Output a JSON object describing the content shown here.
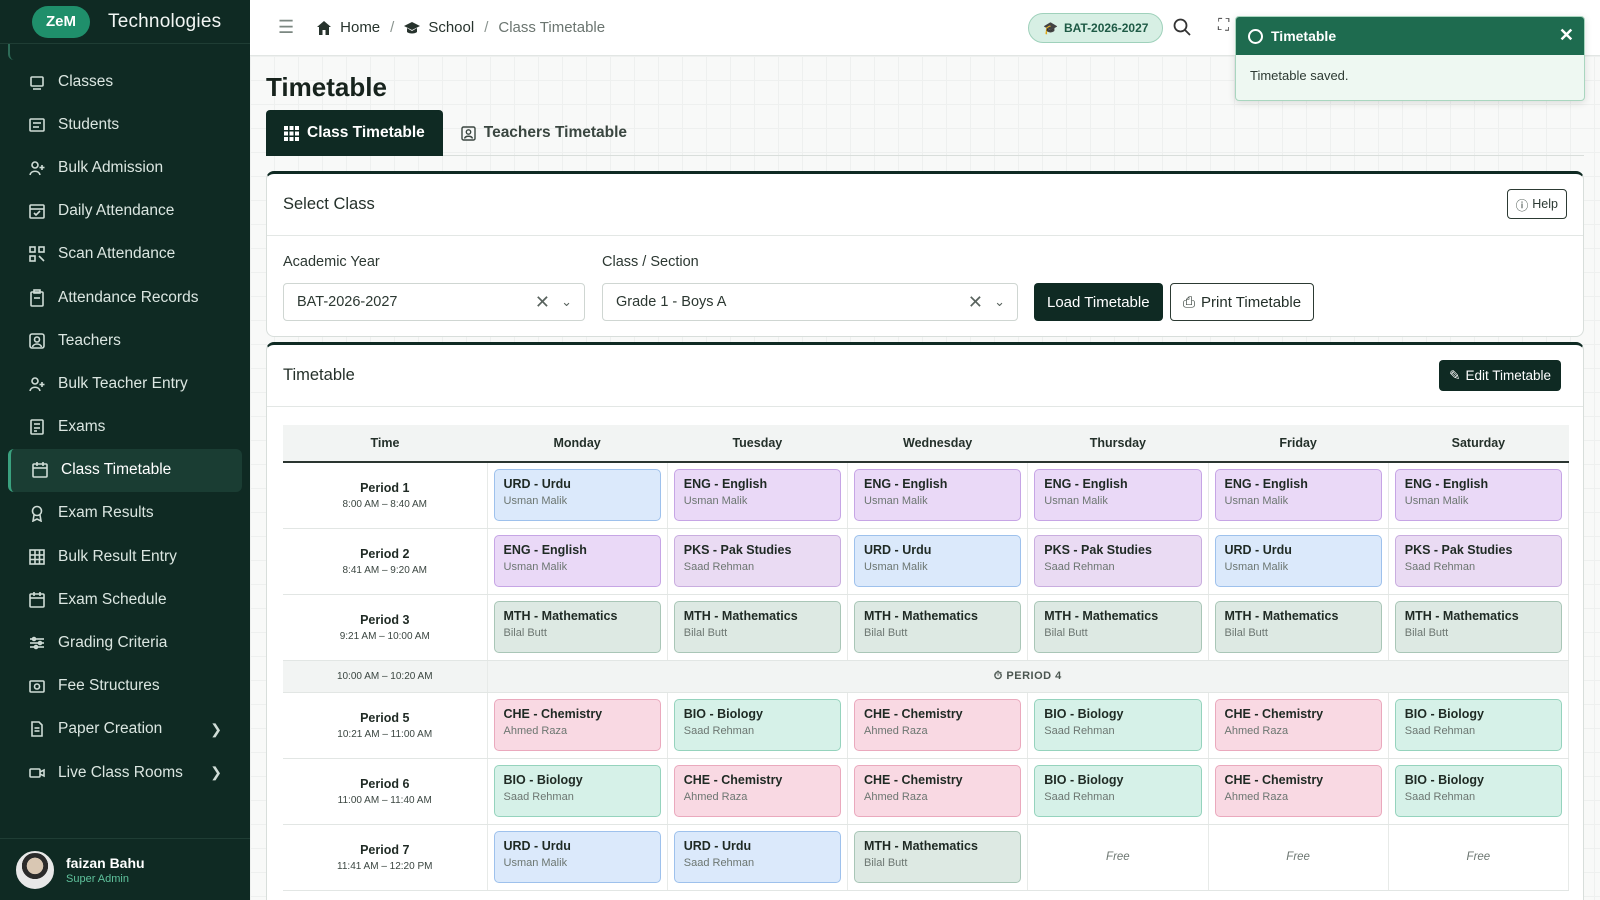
{
  "brand": {
    "logo": "ZeM",
    "name": "Technologies"
  },
  "sidebar": {
    "items": [
      {
        "label": "Classes",
        "icon": "classes-icon"
      },
      {
        "label": "Students",
        "icon": "students-icon"
      },
      {
        "label": "Bulk Admission",
        "icon": "user-plus-icon"
      },
      {
        "label": "Daily Attendance",
        "icon": "calendar-check-icon"
      },
      {
        "label": "Scan Attendance",
        "icon": "qr-scan-icon"
      },
      {
        "label": "Attendance Records",
        "icon": "clipboard-icon"
      },
      {
        "label": "Teachers",
        "icon": "teacher-icon"
      },
      {
        "label": "Bulk Teacher Entry",
        "icon": "user-add-icon"
      },
      {
        "label": "Exams",
        "icon": "exam-icon"
      },
      {
        "label": "Class Timetable",
        "icon": "calendar-icon",
        "active": true
      },
      {
        "label": "Exam Results",
        "icon": "award-icon"
      },
      {
        "label": "Bulk Result Entry",
        "icon": "grid-icon"
      },
      {
        "label": "Exam Schedule",
        "icon": "calendar-icon"
      },
      {
        "label": "Grading Criteria",
        "icon": "sliders-icon"
      },
      {
        "label": "Fee Structures",
        "icon": "wallet-icon"
      },
      {
        "label": "Paper Creation",
        "icon": "document-icon",
        "chevron": true
      },
      {
        "label": "Live Class Rooms",
        "icon": "video-icon",
        "chevron": true
      }
    ],
    "user": {
      "name": "faizan Bahu",
      "role": "Super Admin"
    }
  },
  "topbar": {
    "breadcrumb": [
      "Home",
      "School",
      "Class Timetable"
    ],
    "academic_year": "BAT-2026-2027"
  },
  "toast": {
    "title": "Timetable",
    "message": "Timetable saved."
  },
  "page": {
    "title": "Timetable",
    "tabs": [
      "Class Timetable",
      "Teachers Timetable"
    ]
  },
  "select_card": {
    "title": "Select Class",
    "help_label": "Help",
    "academic_year_label": "Academic Year",
    "academic_year_value": "BAT-2026-2027",
    "class_label": "Class / Section",
    "class_value": "Grade 1 - Boys A",
    "load_label": "Load Timetable",
    "print_label": "Print Timetable"
  },
  "timetable": {
    "title": "Timetable",
    "edit_label": "Edit Timetable",
    "headers": [
      "Time",
      "Monday",
      "Tuesday",
      "Wednesday",
      "Thursday",
      "Friday",
      "Saturday"
    ],
    "free_label": "Free",
    "rows": [
      {
        "name": "Period 1",
        "time": "8:00 AM – 8:40 AM",
        "slots": [
          [
            "urd",
            "URD - Urdu",
            "Usman Malik"
          ],
          [
            "eng",
            "ENG - English",
            "Usman Malik"
          ],
          [
            "eng",
            "ENG - English",
            "Usman Malik"
          ],
          [
            "eng",
            "ENG - English",
            "Usman Malik"
          ],
          [
            "eng",
            "ENG - English",
            "Usman Malik"
          ],
          [
            "eng",
            "ENG - English",
            "Usman Malik"
          ]
        ]
      },
      {
        "name": "Period 2",
        "time": "8:41 AM – 9:20 AM",
        "slots": [
          [
            "eng",
            "ENG - English",
            "Usman Malik"
          ],
          [
            "pks",
            "PKS - Pak Studies",
            "Saad Rehman"
          ],
          [
            "urd",
            "URD - Urdu",
            "Usman Malik"
          ],
          [
            "pks",
            "PKS - Pak Studies",
            "Saad Rehman"
          ],
          [
            "urd",
            "URD - Urdu",
            "Usman Malik"
          ],
          [
            "pks",
            "PKS - Pak Studies",
            "Saad Rehman"
          ]
        ]
      },
      {
        "name": "Period 3",
        "time": "9:21 AM – 10:00 AM",
        "slots": [
          [
            "mth",
            "MTH - Mathematics",
            "Bilal Butt"
          ],
          [
            "mth",
            "MTH - Mathematics",
            "Bilal Butt"
          ],
          [
            "mth",
            "MTH - Mathematics",
            "Bilal Butt"
          ],
          [
            "mth",
            "MTH - Mathematics",
            "Bilal Butt"
          ],
          [
            "mth",
            "MTH - Mathematics",
            "Bilal Butt"
          ],
          [
            "mth",
            "MTH - Mathematics",
            "Bilal Butt"
          ]
        ]
      },
      {
        "break": true,
        "time": "10:00 AM – 10:20 AM",
        "label": "PERIOD 4"
      },
      {
        "name": "Period 5",
        "time": "10:21 AM – 11:00 AM",
        "slots": [
          [
            "che",
            "CHE - Chemistry",
            "Ahmed Raza"
          ],
          [
            "bio",
            "BIO - Biology",
            "Saad Rehman"
          ],
          [
            "che",
            "CHE - Chemistry",
            "Ahmed Raza"
          ],
          [
            "bio",
            "BIO - Biology",
            "Saad Rehman"
          ],
          [
            "che",
            "CHE - Chemistry",
            "Ahmed Raza"
          ],
          [
            "bio",
            "BIO - Biology",
            "Saad Rehman"
          ]
        ]
      },
      {
        "name": "Period 6",
        "time": "11:00 AM – 11:40 AM",
        "slots": [
          [
            "bio",
            "BIO - Biology",
            "Saad Rehman"
          ],
          [
            "che",
            "CHE - Chemistry",
            "Ahmed Raza"
          ],
          [
            "che",
            "CHE - Chemistry",
            "Ahmed Raza"
          ],
          [
            "bio",
            "BIO - Biology",
            "Saad Rehman"
          ],
          [
            "che",
            "CHE - Chemistry",
            "Ahmed Raza"
          ],
          [
            "bio",
            "BIO - Biology",
            "Saad Rehman"
          ]
        ]
      },
      {
        "name": "Period 7",
        "time": "11:41 AM – 12:20 PM",
        "slots": [
          [
            "urd",
            "URD - Urdu",
            "Usman Malik"
          ],
          [
            "urd",
            "URD - Urdu",
            "Saad Rehman"
          ],
          [
            "mth",
            "MTH - Mathematics",
            "Bilal Butt"
          ],
          null,
          null,
          null
        ]
      }
    ]
  }
}
